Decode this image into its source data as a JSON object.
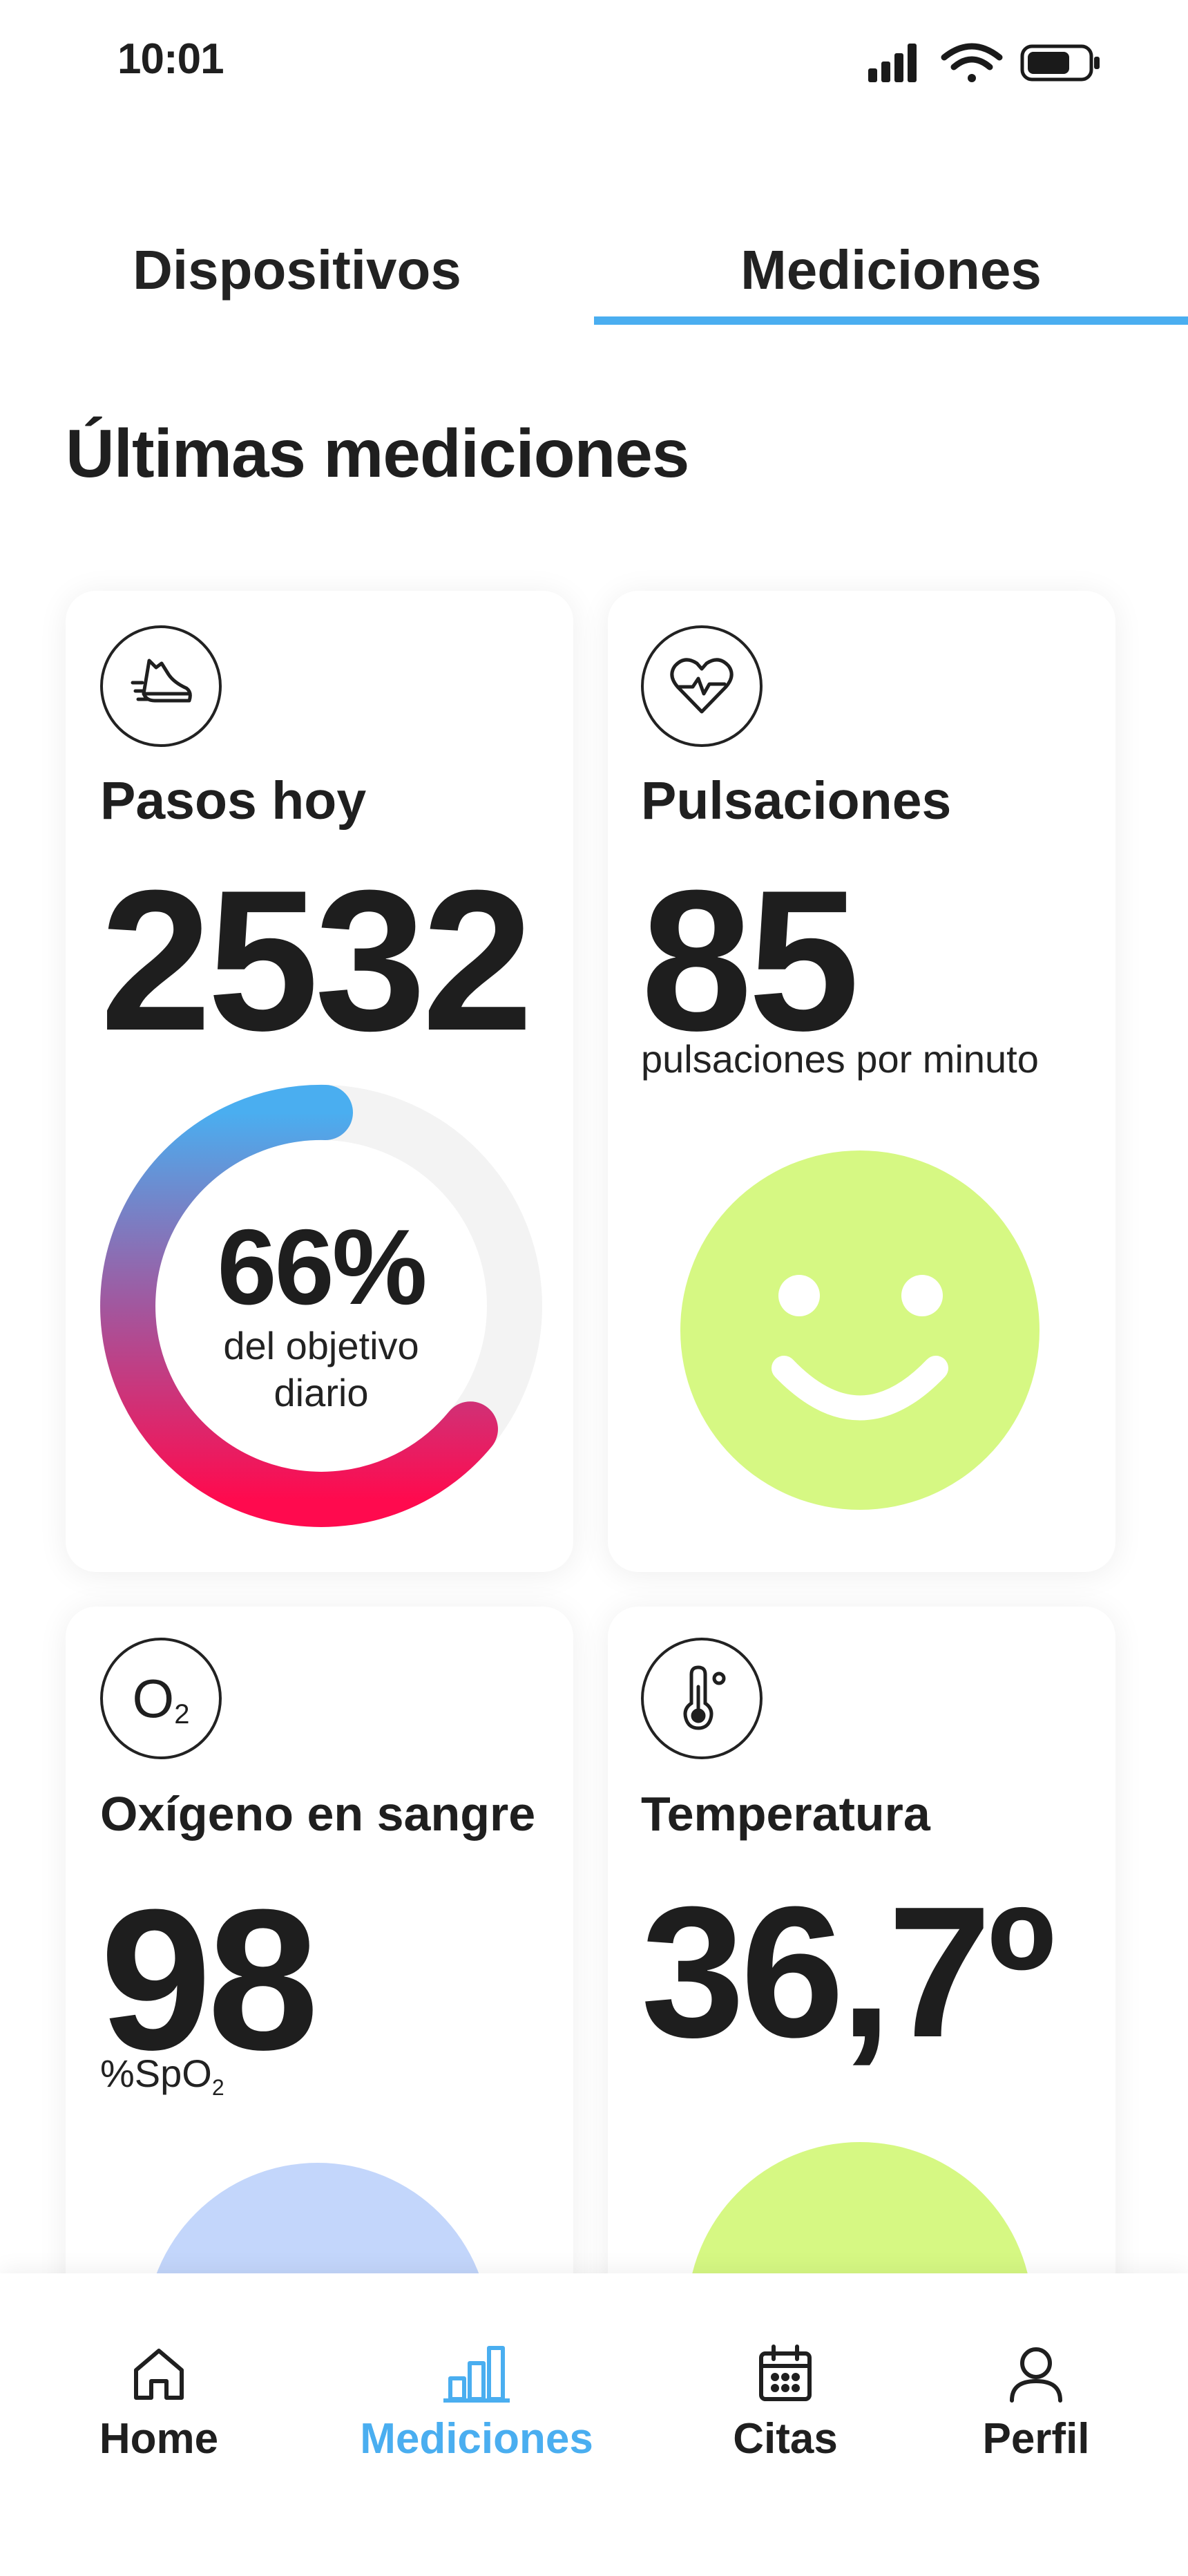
{
  "status_bar": {
    "time": "10:01"
  },
  "tabs": [
    {
      "label": "Dispositivos",
      "active": false
    },
    {
      "label": "Mediciones",
      "active": true
    }
  ],
  "section_title": "Últimas mediciones",
  "cards": {
    "steps": {
      "icon": "shoe-icon",
      "title": "Pasos hoy",
      "value": "2532",
      "progress_percent": 66,
      "progress_label": "66%",
      "progress_caption_line1": "del objetivo",
      "progress_caption_line2": "diario"
    },
    "pulse": {
      "icon": "heart-pulse-icon",
      "title": "Pulsaciones",
      "value": "85",
      "unit": "pulsaciones por minuto",
      "status_icon": "smiley-face-icon",
      "status_color": "#d6f883"
    },
    "oxygen": {
      "icon": "oxygen-icon",
      "icon_text": "O",
      "icon_sub": "2",
      "title": "Oxígeno en sangre",
      "value": "98",
      "unit": "%SpO",
      "unit_sub": "2",
      "status_color": "#c3d6fb"
    },
    "temperature": {
      "icon": "thermometer-icon",
      "title": "Temperatura",
      "value": "36,7º",
      "status_color": "#d6f883"
    }
  },
  "bottom_nav": [
    {
      "label": "Home",
      "icon": "home-icon",
      "active": false
    },
    {
      "label": "Mediciones",
      "icon": "bar-chart-icon",
      "active": true
    },
    {
      "label": "Citas",
      "icon": "calendar-icon",
      "active": false
    },
    {
      "label": "Perfil",
      "icon": "user-icon",
      "active": false
    }
  ],
  "colors": {
    "accent": "#4aaef0",
    "gradient_start": "#4aaef0",
    "gradient_mid": "#a2579e",
    "gradient_end": "#ff0a4e",
    "ring_track": "#f3f3f3"
  }
}
